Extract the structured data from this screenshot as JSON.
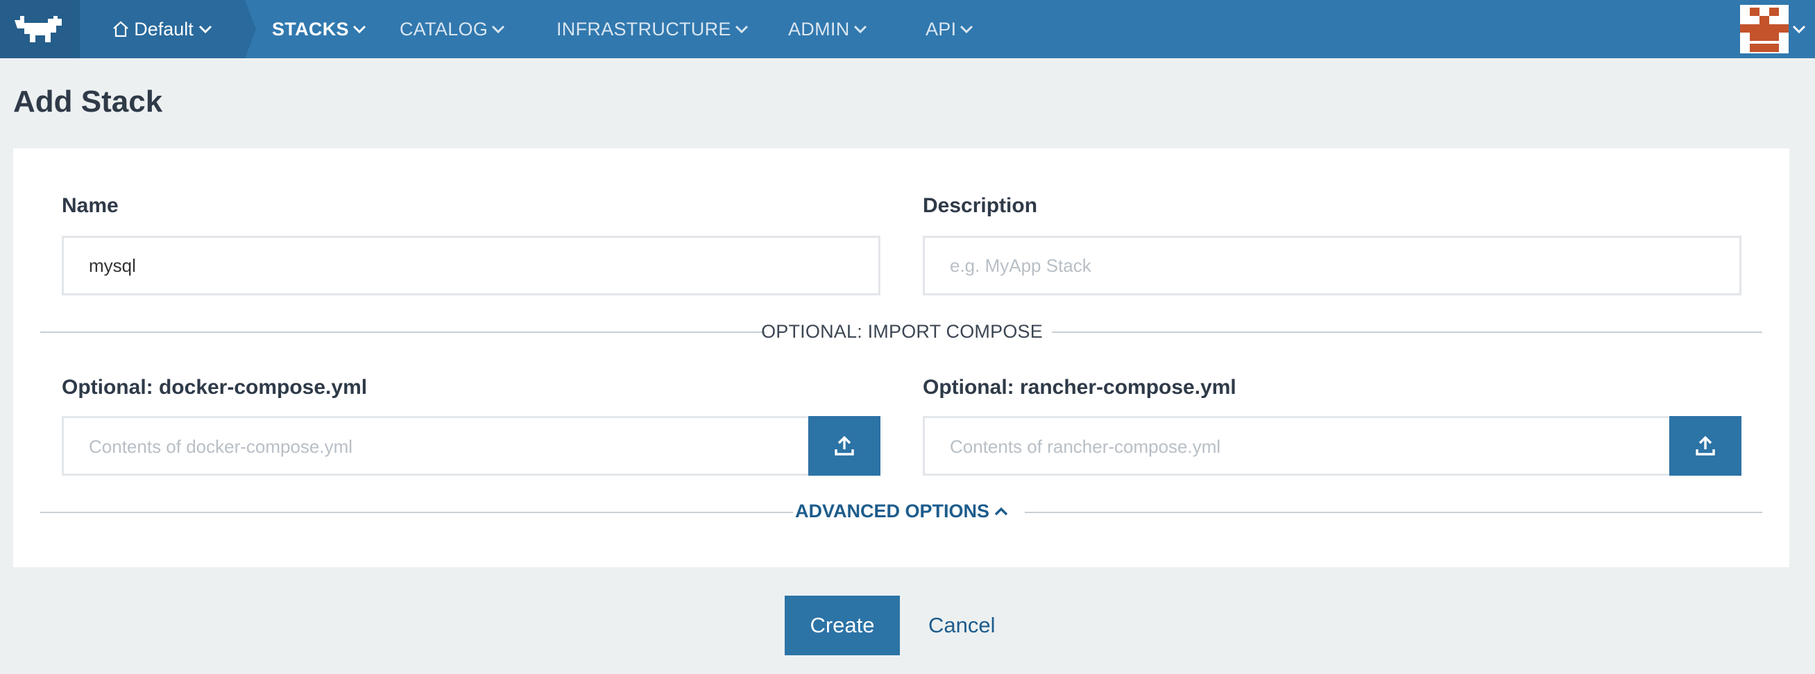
{
  "nav": {
    "logo_icon": "rancher-cow-logo",
    "environment": "Default",
    "items": [
      {
        "label": "STACKS",
        "active": true
      },
      {
        "label": "CATALOG",
        "active": false
      },
      {
        "label": "INFRASTRUCTURE",
        "active": false
      },
      {
        "label": "ADMIN",
        "active": false
      },
      {
        "label": "API",
        "active": false
      }
    ],
    "avatar_icon": "user-avatar-identicon"
  },
  "page": {
    "title": "Add Stack"
  },
  "form": {
    "name_label": "Name",
    "name_value": "mysql",
    "description_label": "Description",
    "description_placeholder": "e.g. MyApp Stack",
    "import_divider": "OPTIONAL: IMPORT COMPOSE",
    "docker_compose_label": "Optional: docker-compose.yml",
    "docker_compose_placeholder": "Contents of docker-compose.yml",
    "rancher_compose_label": "Optional: rancher-compose.yml",
    "rancher_compose_placeholder": "Contents of rancher-compose.yml",
    "advanced_options": "ADVANCED OPTIONS"
  },
  "actions": {
    "create": "Create",
    "cancel": "Cancel"
  },
  "colors": {
    "nav_bg": "#3178ae",
    "primary": "#2c73a6",
    "page_bg": "#ecf0f1"
  }
}
